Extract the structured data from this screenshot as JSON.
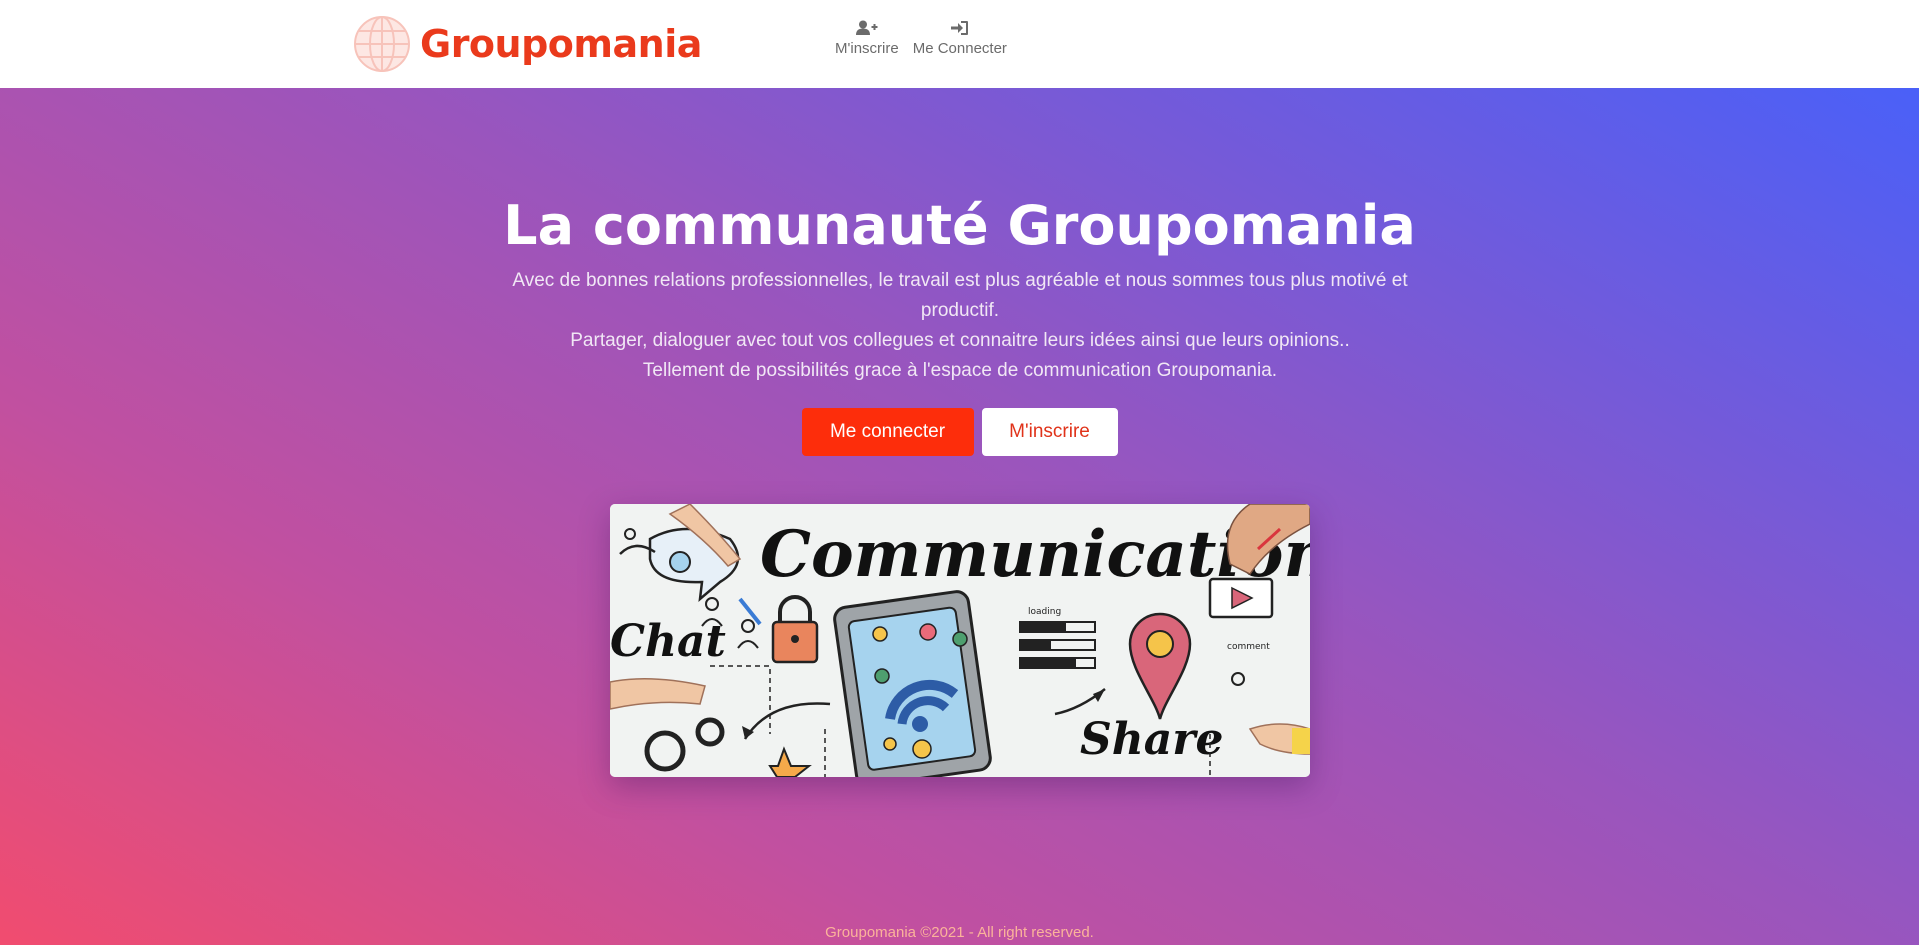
{
  "brand": {
    "name": "Groupomania",
    "logo_icon": "globe-icon",
    "color": "#ea3a1c"
  },
  "nav": {
    "items": [
      {
        "label": "M'inscrire",
        "icon": "user-plus-icon"
      },
      {
        "label": "Me Connecter",
        "icon": "sign-in-icon"
      }
    ]
  },
  "hero": {
    "title": "La communauté Groupomania",
    "lines": [
      "Avec de bonnes relations professionnelles, le travail est plus agréable et nous sommes tous plus motivé et productif.",
      "Partager, dialoguer avec tout vos collegues et connaitre leurs idées ainsi que leurs opinions..",
      "Tellement de possibilités grace à l'espace de communication Groupomania."
    ],
    "buttons": {
      "login": "Me connecter",
      "signup": "M'inscrire"
    },
    "image": {
      "words": [
        "Communication",
        "Chat",
        "Share",
        "loading",
        "comment"
      ]
    }
  },
  "footer": {
    "text": "Groupomania ©2021 - All right reserved."
  },
  "colors": {
    "primary": "#fd2d0b",
    "gradient_start": "#f14c6f",
    "gradient_end": "#4a60f8"
  }
}
